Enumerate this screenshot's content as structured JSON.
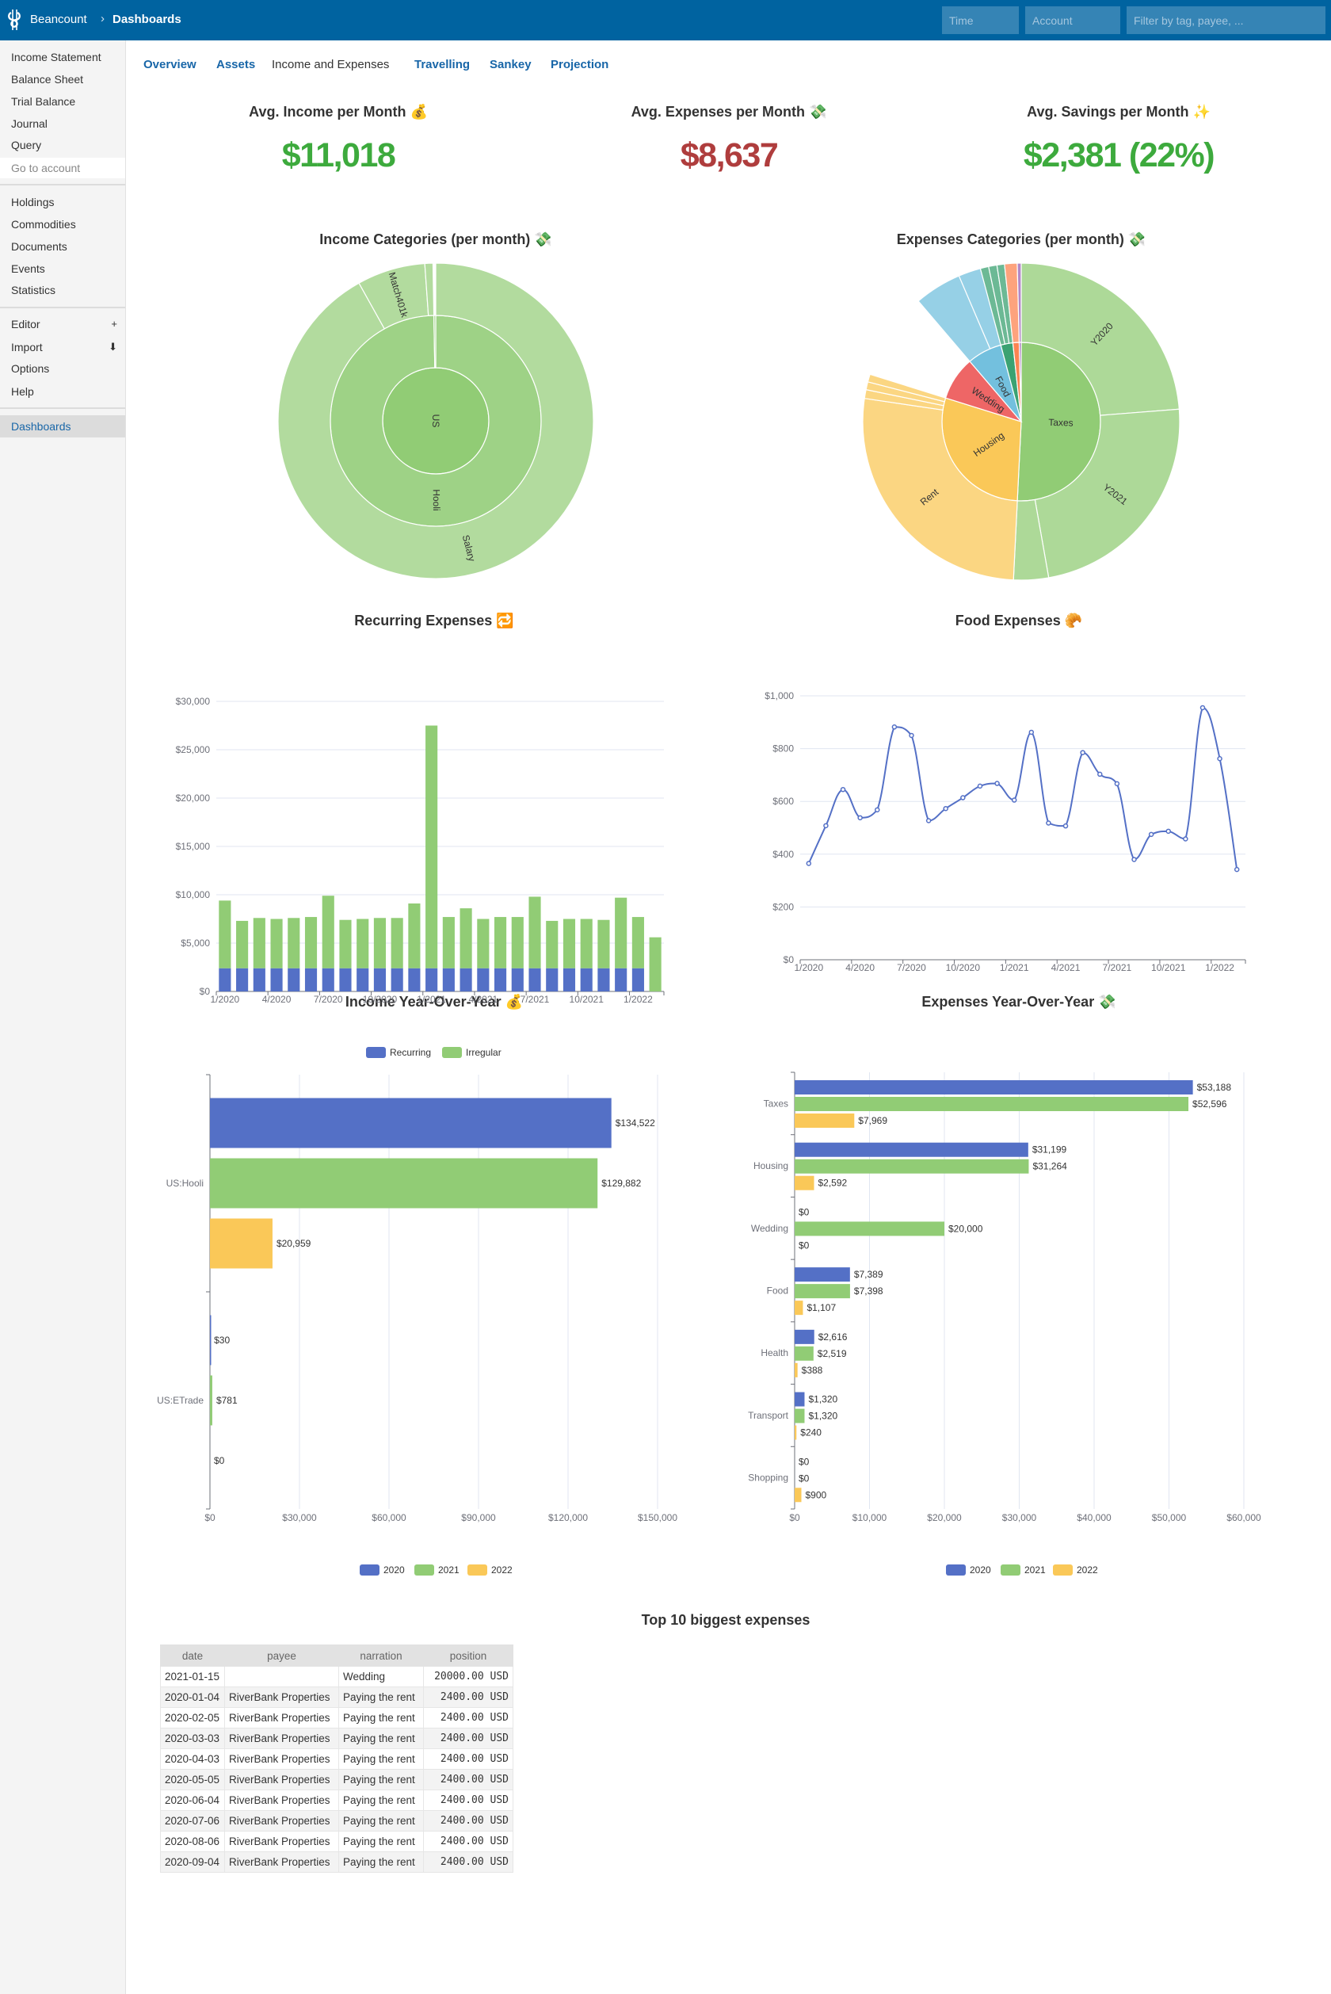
{
  "header": {
    "brand": "Beancount",
    "separator": "›",
    "page": "Dashboards",
    "time_placeholder": "Time",
    "account_placeholder": "Account",
    "filter_placeholder": "Filter by tag, payee, ..."
  },
  "sidebar": {
    "reports": [
      "Income Statement",
      "Balance Sheet",
      "Trial Balance",
      "Journal",
      "Query"
    ],
    "go_to_account_placeholder": "Go to account",
    "views": [
      "Holdings",
      "Commodities",
      "Documents",
      "Events",
      "Statistics"
    ],
    "tools": [
      {
        "label": "Editor",
        "suffix": "+"
      },
      {
        "label": "Import",
        "suffix": "⬇"
      },
      {
        "label": "Options",
        "suffix": ""
      },
      {
        "label": "Help",
        "suffix": ""
      }
    ],
    "extensions": [
      "Dashboards"
    ],
    "active": "Dashboards"
  },
  "tabs": [
    "Overview",
    "Assets",
    "Income and Expenses",
    "Travelling",
    "Sankey",
    "Projection"
  ],
  "active_tab": "Income and Expenses",
  "kpis": [
    {
      "title": "Avg. Income per Month 💰",
      "value": "$11,018",
      "color": "#3daa3d"
    },
    {
      "title": "Avg. Expenses per Month 💸",
      "value": "$8,637",
      "color": "#af3d3d"
    },
    {
      "title": "Avg. Savings per Month ✨",
      "value": "$2,381 (22%)",
      "color": "#3daa3d"
    }
  ],
  "colors": {
    "c2020": "#5470c6",
    "c2021": "#91cc75",
    "c2022": "#fac858",
    "line": "#5470c6",
    "grid": "#e0e6f1",
    "axis": "#6e7079"
  },
  "chart_data": [
    {
      "type": "sunburst",
      "title": "Income Categories (per month) 💸",
      "data": [
        {
          "name": "US",
          "value": 286174,
          "color": "#91cc75",
          "children": [
            {
              "name": "Hooli",
              "value": 285363,
              "children": [
                {
                  "name": "Salary",
                  "value": 263000
                },
                {
                  "name": "Match401k",
                  "value": 20000
                },
                {
                  "name": "",
                  "value": 2363
                }
              ]
            },
            {
              "name": "",
              "value": 811,
              "children": []
            }
          ]
        }
      ]
    },
    {
      "type": "sunburst",
      "title": "Expenses Categories (per month) 💸",
      "data": [
        {
          "name": "Taxes",
          "value": 113753,
          "color": "#91cc75",
          "children": [
            {
              "name": "Y2020",
              "value": 53188
            },
            {
              "name": "Y2021",
              "value": 52596
            },
            {
              "name": "",
              "value": 7969
            }
          ]
        },
        {
          "name": "Housing",
          "value": 65055,
          "color": "#fac858",
          "children": [
            {
              "name": "Rent",
              "value": 59500
            },
            {
              "name": "",
              "value": 2000
            },
            {
              "name": "",
              "value": 1800
            },
            {
              "name": "",
              "value": 1755
            }
          ]
        },
        {
          "name": "Wedding",
          "value": 20000,
          "color": "#ee6666",
          "children": []
        },
        {
          "name": "Food",
          "value": 15894,
          "color": "#73c0de",
          "children": [
            {
              "name": "",
              "value": 10800
            },
            {
              "name": "",
              "value": 5094
            }
          ]
        },
        {
          "name": "",
          "value": 5523,
          "color": "#3ba272",
          "children": [
            {
              "name": "",
              "value": 1900
            },
            {
              "name": "",
              "value": 1900
            },
            {
              "name": "",
              "value": 1723
            }
          ]
        },
        {
          "name": "",
          "value": 2880,
          "color": "#fc8452",
          "children": [
            {
              "name": "",
              "value": 2880
            }
          ]
        },
        {
          "name": "",
          "value": 900,
          "color": "#9a60b4",
          "children": [
            {
              "name": "",
              "value": 900
            }
          ]
        }
      ]
    },
    {
      "type": "bar",
      "stacked": true,
      "title": "Recurring Expenses 🔁",
      "categories": [
        "1/2020",
        "2/2020",
        "3/2020",
        "4/2020",
        "5/2020",
        "6/2020",
        "7/2020",
        "8/2020",
        "9/2020",
        "10/2020",
        "11/2020",
        "12/2020",
        "1/2021",
        "2/2021",
        "3/2021",
        "4/2021",
        "5/2021",
        "6/2021",
        "7/2021",
        "8/2021",
        "9/2021",
        "10/2021",
        "11/2021",
        "12/2021",
        "1/2022",
        "2/2022"
      ],
      "series": [
        {
          "name": "Recurring",
          "color": "#5470c6",
          "values": [
            2400,
            2400,
            2400,
            2400,
            2400,
            2400,
            2400,
            2400,
            2400,
            2400,
            2400,
            2400,
            2400,
            2400,
            2400,
            2400,
            2400,
            2400,
            2400,
            2400,
            2400,
            2400,
            2400,
            2400,
            2400,
            0
          ]
        },
        {
          "name": "Irregular",
          "color": "#91cc75",
          "values": [
            7000,
            4900,
            5200,
            5100,
            5200,
            5300,
            7500,
            5000,
            5100,
            5200,
            5200,
            6700,
            25100,
            5300,
            6200,
            5100,
            5300,
            5300,
            7400,
            4900,
            5100,
            5100,
            5000,
            7300,
            5300,
            5600
          ]
        }
      ],
      "yticks": [
        "$0",
        "$5,000",
        "$10,000",
        "$15,000",
        "$20,000",
        "$25,000",
        "$30,000"
      ],
      "ylim": [
        0,
        30000
      ],
      "legend": "bottom",
      "grid": true
    },
    {
      "type": "line",
      "smooth": true,
      "title": "Food Expenses 🥐",
      "categories": [
        "1/2020",
        "2/2020",
        "3/2020",
        "4/2020",
        "5/2020",
        "6/2020",
        "7/2020",
        "8/2020",
        "9/2020",
        "10/2020",
        "11/2020",
        "12/2020",
        "1/2021",
        "2/2021",
        "3/2021",
        "4/2021",
        "5/2021",
        "6/2021",
        "7/2021",
        "8/2021",
        "9/2021",
        "10/2021",
        "11/2021",
        "12/2021",
        "1/2022",
        "2/2022"
      ],
      "values": [
        365,
        508,
        645,
        538,
        568,
        882,
        850,
        527,
        573,
        614,
        658,
        668,
        605,
        862,
        518,
        507,
        785,
        703,
        667,
        380,
        475,
        487,
        458,
        955,
        762,
        342
      ],
      "yticks": [
        "$0",
        "$200",
        "$400",
        "$600",
        "$800",
        "$1,000"
      ],
      "ylim": [
        0,
        1000
      ],
      "grid": true
    },
    {
      "type": "hbar",
      "title": "Income Year-Over-Year 💰",
      "categories": [
        "US:Hooli",
        "US:ETrade"
      ],
      "series": [
        {
          "name": "2020",
          "color": "#5470c6",
          "values": [
            134522,
            30
          ],
          "labels": [
            "$134,522",
            "$30"
          ]
        },
        {
          "name": "2021",
          "color": "#91cc75",
          "values": [
            129882,
            781
          ],
          "labels": [
            "$129,882",
            "$781"
          ]
        },
        {
          "name": "2022",
          "color": "#fac858",
          "values": [
            20959,
            0
          ],
          "labels": [
            "$20,959",
            "$0"
          ]
        }
      ],
      "xticks": [
        "$0",
        "$30,000",
        "$60,000",
        "$90,000",
        "$120,000",
        "$150,000"
      ],
      "xlim": [
        0,
        150000
      ],
      "legend": "bottom",
      "grid": true
    },
    {
      "type": "hbar",
      "title": "Expenses Year-Over-Year 💸",
      "categories": [
        "Taxes",
        "Housing",
        "Wedding",
        "Food",
        "Health",
        "Transport",
        "Shopping"
      ],
      "series": [
        {
          "name": "2020",
          "color": "#5470c6",
          "values": [
            53188,
            31199,
            0,
            7389,
            2616,
            1320,
            0
          ],
          "labels": [
            "$53,188",
            "$31,199",
            "$0",
            "$7,389",
            "$2,616",
            "$1,320",
            "$0"
          ]
        },
        {
          "name": "2021",
          "color": "#91cc75",
          "values": [
            52596,
            31264,
            20000,
            7398,
            2519,
            1320,
            0
          ],
          "labels": [
            "$52,596",
            "$31,264",
            "$20,000",
            "$7,398",
            "$2,519",
            "$1,320",
            "$0"
          ]
        },
        {
          "name": "2022",
          "color": "#fac858",
          "values": [
            7969,
            2592,
            0,
            1107,
            388,
            240,
            900
          ],
          "labels": [
            "$7,969",
            "$2,592",
            "$0",
            "$1,107",
            "$388",
            "$240",
            "$900"
          ]
        }
      ],
      "xticks": [
        "$0",
        "$10,000",
        "$20,000",
        "$30,000",
        "$40,000",
        "$50,000",
        "$60,000"
      ],
      "xlim": [
        0,
        60000
      ],
      "legend": "bottom",
      "grid": true
    }
  ],
  "table": {
    "title": "Top 10 biggest expenses",
    "columns": [
      "date",
      "payee",
      "narration",
      "position"
    ],
    "rows": [
      [
        "2021-01-15",
        "",
        "Wedding",
        "20000.00 USD"
      ],
      [
        "2020-01-04",
        "RiverBank Properties",
        "Paying the rent",
        "2400.00 USD"
      ],
      [
        "2020-02-05",
        "RiverBank Properties",
        "Paying the rent",
        "2400.00 USD"
      ],
      [
        "2020-03-03",
        "RiverBank Properties",
        "Paying the rent",
        "2400.00 USD"
      ],
      [
        "2020-04-03",
        "RiverBank Properties",
        "Paying the rent",
        "2400.00 USD"
      ],
      [
        "2020-05-05",
        "RiverBank Properties",
        "Paying the rent",
        "2400.00 USD"
      ],
      [
        "2020-06-04",
        "RiverBank Properties",
        "Paying the rent",
        "2400.00 USD"
      ],
      [
        "2020-07-06",
        "RiverBank Properties",
        "Paying the rent",
        "2400.00 USD"
      ],
      [
        "2020-08-06",
        "RiverBank Properties",
        "Paying the rent",
        "2400.00 USD"
      ],
      [
        "2020-09-04",
        "RiverBank Properties",
        "Paying the rent",
        "2400.00 USD"
      ]
    ]
  }
}
